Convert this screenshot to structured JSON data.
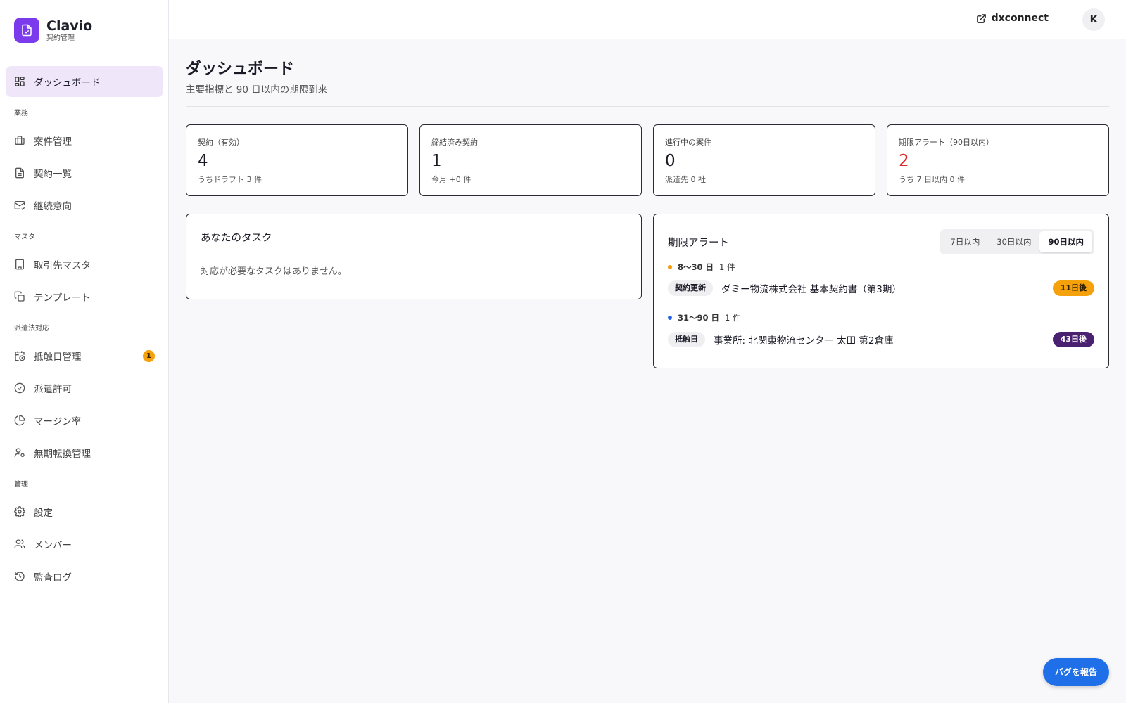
{
  "brand": {
    "name": "Clavio",
    "subtitle": "契約管理"
  },
  "sidebar": {
    "top": {
      "label": "ダッシュボード",
      "icon": "dashboard-icon"
    },
    "sections": [
      {
        "title": "業務",
        "items": [
          {
            "label": "案件管理",
            "icon": "briefcase-icon"
          },
          {
            "label": "契約一覧",
            "icon": "document-icon"
          },
          {
            "label": "継続意向",
            "icon": "mail-check-icon"
          }
        ]
      },
      {
        "title": "マスタ",
        "items": [
          {
            "label": "取引先マスタ",
            "icon": "building-icon"
          },
          {
            "label": "テンプレート",
            "icon": "copy-icon"
          }
        ]
      },
      {
        "title": "派遣法対応",
        "items": [
          {
            "label": "抵触日管理",
            "icon": "calendar-clock-icon",
            "badge": "1"
          },
          {
            "label": "派遣許可",
            "icon": "check-circle-icon"
          },
          {
            "label": "マージン率",
            "icon": "pie-chart-icon"
          },
          {
            "label": "無期転換管理",
            "icon": "user-cog-icon"
          }
        ]
      },
      {
        "title": "管理",
        "items": [
          {
            "label": "設定",
            "icon": "gear-icon"
          },
          {
            "label": "メンバー",
            "icon": "users-icon"
          },
          {
            "label": "監査ログ",
            "icon": "history-icon"
          }
        ]
      }
    ]
  },
  "header": {
    "link_label": "dxconnect",
    "avatar_initial": "K"
  },
  "page": {
    "title": "ダッシュボード",
    "subtitle": "主要指標と 90 日以内の期限到来"
  },
  "kpis": [
    {
      "label": "契約（有効）",
      "value": "4",
      "sub": "うちドラフト 3 件"
    },
    {
      "label": "締結済み契約",
      "value": "1",
      "sub": "今月 +0 件"
    },
    {
      "label": "進行中の案件",
      "value": "0",
      "sub": "派遣先 0 社"
    },
    {
      "label": "期限アラート（90日以内）",
      "value": "2",
      "sub": "うち 7 日以内 0 件"
    }
  ],
  "tasks": {
    "title": "あなたのタスク",
    "empty": "対応が必要なタスクはありません。"
  },
  "alerts": {
    "title": "期限アラート",
    "tabs": [
      "7日以内",
      "30日以内",
      "90日以内"
    ],
    "active_tab": "90日以内",
    "groups": [
      {
        "range": "8〜30 日",
        "count": "1 件",
        "dot_color": "#f59e0b",
        "item": {
          "tag": "契約更新",
          "title": "ダミー物流株式会社 基本契約書（第3期）",
          "due": "11日後",
          "due_bg": "#f5a10b",
          "due_fg": "#2a1a00"
        }
      },
      {
        "range": "31〜90 日",
        "count": "1 件",
        "dot_color": "#2563eb",
        "item": {
          "tag": "抵触日",
          "title": "事業所: 北関東物流センター 太田 第2倉庫",
          "due": "43日後",
          "due_bg": "#4a2170",
          "due_fg": "#ffffff"
        }
      }
    ]
  },
  "fab": {
    "label": "バグを報告"
  },
  "colors": {
    "accent": "#7c3aed",
    "alert_value": "#dc2626",
    "fab": "#1f6fe8"
  }
}
